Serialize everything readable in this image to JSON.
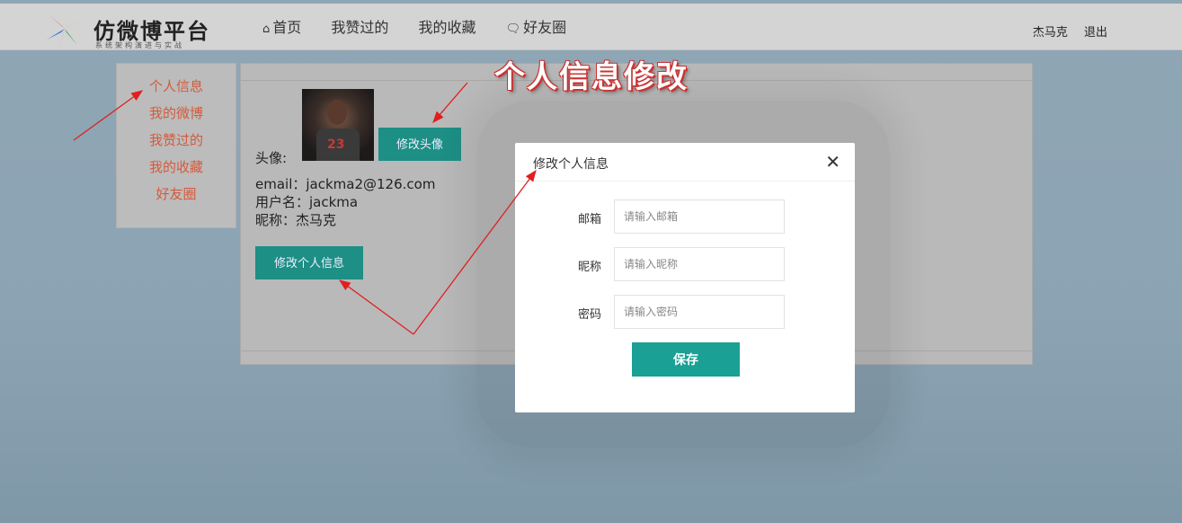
{
  "header": {
    "logo_title": "仿微博平台",
    "logo_subtitle": "系统架构演进与实战",
    "nav": [
      {
        "label": "首页",
        "icon": "home-icon"
      },
      {
        "label": "我赞过的"
      },
      {
        "label": "我的收藏"
      },
      {
        "label": "好友圈",
        "icon": "chat-icon"
      }
    ],
    "username": "杰马克",
    "logout": "退出"
  },
  "sidebar": {
    "items": [
      {
        "label": "个人信息"
      },
      {
        "label": "我的微博"
      },
      {
        "label": "我赞过的"
      },
      {
        "label": "我的收藏"
      },
      {
        "label": "好友圈"
      }
    ]
  },
  "profile": {
    "avatar_label": "头像:",
    "avatar_number": "23",
    "change_avatar_button": "修改头像",
    "email": "email：jackma2@126.com",
    "username": "用户名：jackma",
    "nickname": "昵称：杰马克",
    "edit_button": "修改个人信息"
  },
  "modal": {
    "title": "修改个人信息",
    "close": "✕",
    "fields": [
      {
        "label": "邮箱",
        "placeholder": "请输入邮箱",
        "value": ""
      },
      {
        "label": "昵称",
        "placeholder": "请输入昵称",
        "value": ""
      },
      {
        "label": "密码",
        "placeholder": "请输入密码",
        "value": ""
      }
    ],
    "save_button": "保存"
  },
  "annotation": {
    "text": "个人信息修改",
    "color": "#e53935"
  },
  "colors": {
    "accent": "#1aa094",
    "sidebar_link": "#d35b3c"
  }
}
